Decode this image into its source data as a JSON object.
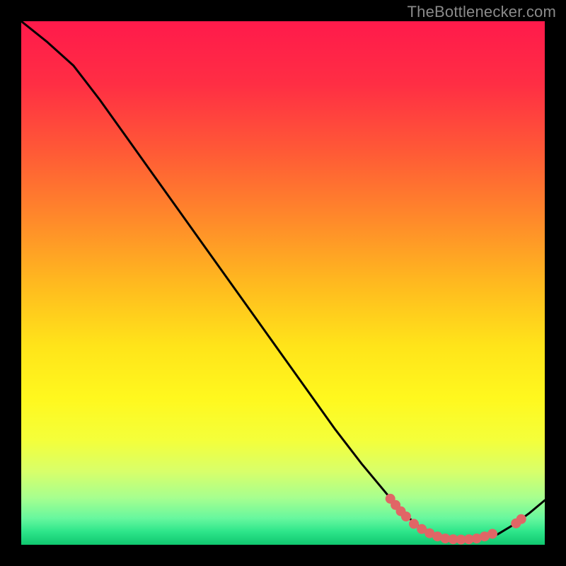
{
  "attribution": "TheBottlenecker.com",
  "chart_data": {
    "type": "line",
    "title": "",
    "xlabel": "",
    "ylabel": "",
    "xlim": [
      0,
      100
    ],
    "ylim": [
      0,
      100
    ],
    "series": [
      {
        "name": "curve",
        "x": [
          0,
          5,
          10,
          15,
          20,
          25,
          30,
          35,
          40,
          45,
          50,
          55,
          60,
          65,
          70,
          73,
          76,
          79,
          82,
          85,
          88,
          91,
          94,
          97,
          100
        ],
        "y": [
          100,
          96,
          91.5,
          85,
          78,
          71,
          64,
          57,
          50,
          43,
          36,
          29,
          22,
          15.5,
          9.5,
          6,
          3.5,
          2,
          1.2,
          1,
          1.2,
          2,
          3.8,
          6,
          8.5
        ]
      }
    ],
    "markers": [
      {
        "x": 70.5,
        "y": 8.8
      },
      {
        "x": 71.5,
        "y": 7.6
      },
      {
        "x": 72.5,
        "y": 6.4
      },
      {
        "x": 73.5,
        "y": 5.4
      },
      {
        "x": 75.0,
        "y": 4.0
      },
      {
        "x": 76.5,
        "y": 3.0
      },
      {
        "x": 78.0,
        "y": 2.2
      },
      {
        "x": 79.5,
        "y": 1.6
      },
      {
        "x": 81.0,
        "y": 1.2
      },
      {
        "x": 82.5,
        "y": 1.05
      },
      {
        "x": 84.0,
        "y": 1.0
      },
      {
        "x": 85.5,
        "y": 1.05
      },
      {
        "x": 87.0,
        "y": 1.2
      },
      {
        "x": 88.5,
        "y": 1.6
      },
      {
        "x": 90.0,
        "y": 2.1
      },
      {
        "x": 94.5,
        "y": 4.1
      },
      {
        "x": 95.5,
        "y": 4.9
      }
    ],
    "gradient_stops": [
      {
        "t": 0.0,
        "color": "#ff1a4b"
      },
      {
        "t": 0.12,
        "color": "#ff2e44"
      },
      {
        "t": 0.25,
        "color": "#ff5a36"
      },
      {
        "t": 0.38,
        "color": "#ff8a2a"
      },
      {
        "t": 0.5,
        "color": "#ffb91f"
      },
      {
        "t": 0.62,
        "color": "#ffe41a"
      },
      {
        "t": 0.72,
        "color": "#fff81e"
      },
      {
        "t": 0.8,
        "color": "#f4ff3a"
      },
      {
        "t": 0.86,
        "color": "#d8ff6a"
      },
      {
        "t": 0.91,
        "color": "#a7ff8f"
      },
      {
        "t": 0.95,
        "color": "#66f79e"
      },
      {
        "t": 0.975,
        "color": "#2de58a"
      },
      {
        "t": 1.0,
        "color": "#10c76f"
      }
    ],
    "marker_color": "#e06666",
    "line_color": "#000000"
  }
}
